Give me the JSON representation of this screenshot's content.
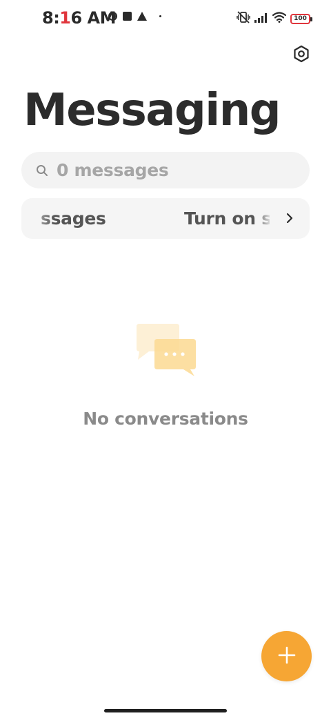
{
  "status_bar": {
    "time_prefix": "8:",
    "time_red": "1",
    "time_suffix": "6 AM",
    "battery_level": "100",
    "battery_color": "#e0363d"
  },
  "header": {
    "title": "Messaging",
    "settings_icon": "gear-icon"
  },
  "search": {
    "placeholder": "0 messages",
    "icon": "search-icon"
  },
  "banner": {
    "left_text": "ssages",
    "right_text": "Turn on s",
    "icon": "chevron-right-icon"
  },
  "empty_state": {
    "icon": "chat-bubbles-icon",
    "text": "No conversations"
  },
  "fab": {
    "icon": "plus-icon",
    "color": "#f6a634"
  },
  "colors": {
    "accent": "#f6a634",
    "title": "#2c2c2c",
    "muted": "#8a8a8a"
  }
}
